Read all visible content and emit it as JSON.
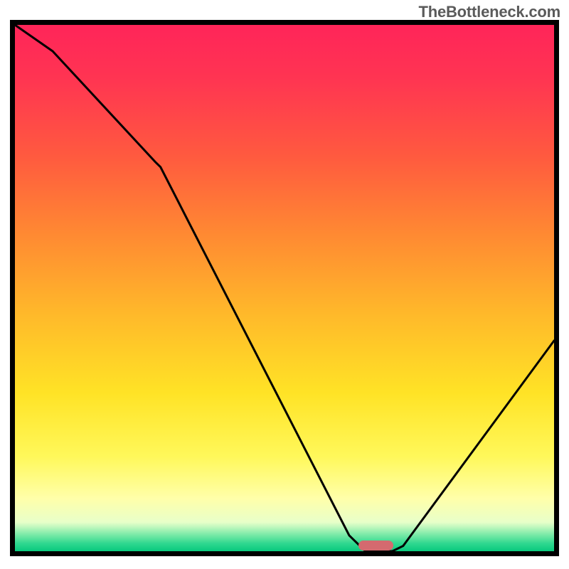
{
  "watermark": "TheBottleneck.com",
  "chart_data": {
    "type": "line",
    "title": "",
    "xlabel": "",
    "ylabel": "",
    "xlim": [
      0,
      100
    ],
    "ylim": [
      0,
      100
    ],
    "series": [
      {
        "name": "bottleneck-curve",
        "x": [
          0,
          7,
          26,
          27,
          62,
          65,
          70,
          72,
          100
        ],
        "values": [
          100,
          95,
          74,
          73,
          3,
          0,
          0,
          1,
          40
        ]
      }
    ],
    "background_gradient_stops": [
      {
        "pos": 0.0,
        "color": "#ff2559"
      },
      {
        "pos": 0.1,
        "color": "#ff3452"
      },
      {
        "pos": 0.25,
        "color": "#ff5a3f"
      },
      {
        "pos": 0.4,
        "color": "#ff8a32"
      },
      {
        "pos": 0.55,
        "color": "#ffb92a"
      },
      {
        "pos": 0.7,
        "color": "#ffe326"
      },
      {
        "pos": 0.82,
        "color": "#fff85a"
      },
      {
        "pos": 0.9,
        "color": "#ffffaa"
      },
      {
        "pos": 0.945,
        "color": "#e8ffc9"
      },
      {
        "pos": 0.955,
        "color": "#baf7bc"
      },
      {
        "pos": 0.965,
        "color": "#8bedad"
      },
      {
        "pos": 0.975,
        "color": "#5ee39e"
      },
      {
        "pos": 0.985,
        "color": "#30d890"
      },
      {
        "pos": 1.0,
        "color": "#08c97e"
      }
    ],
    "marker": {
      "name": "optimal-range",
      "x_center": 67,
      "y_value": 0,
      "width_pct": 6.5,
      "height_pct": 1.8,
      "color": "#d46a6f"
    }
  }
}
